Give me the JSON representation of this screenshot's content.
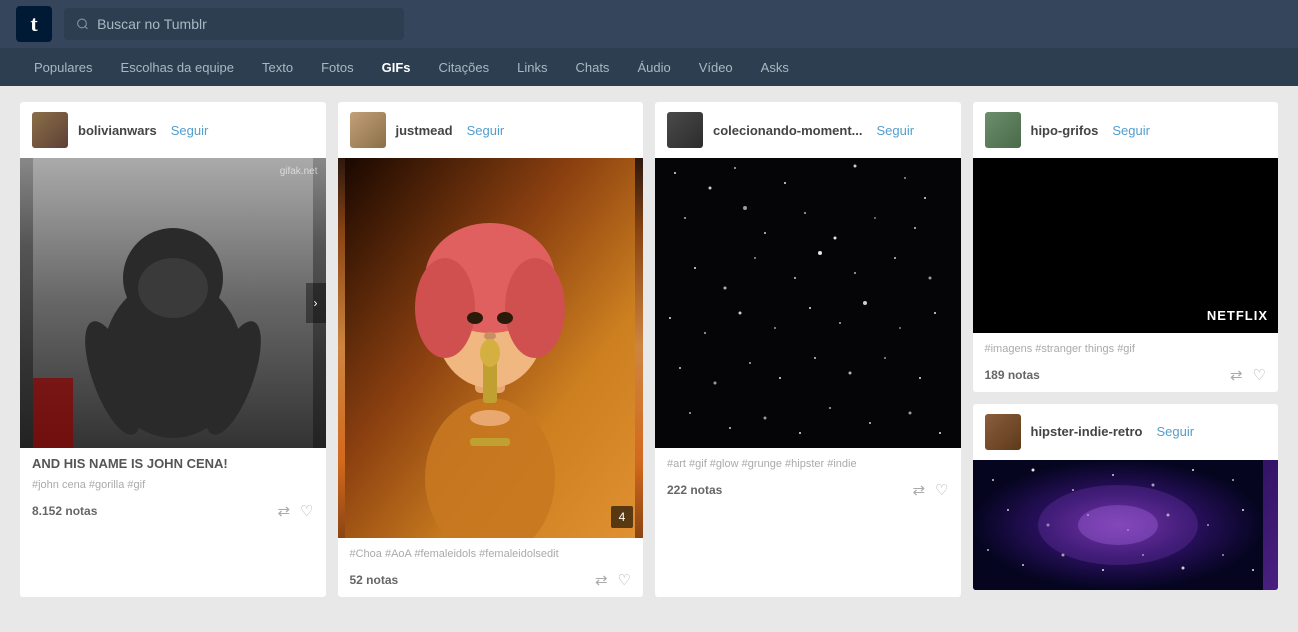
{
  "app": {
    "logo": "t",
    "search_placeholder": "Buscar no Tumblr"
  },
  "nav": {
    "items": [
      {
        "label": "Populares",
        "active": false
      },
      {
        "label": "Escolhas da equipe",
        "active": false
      },
      {
        "label": "Texto",
        "active": false
      },
      {
        "label": "Fotos",
        "active": false
      },
      {
        "label": "GIFs",
        "active": true
      },
      {
        "label": "Citações",
        "active": false
      },
      {
        "label": "Links",
        "active": false
      },
      {
        "label": "Chats",
        "active": false
      },
      {
        "label": "Áudio",
        "active": false
      },
      {
        "label": "Vídeo",
        "active": false
      },
      {
        "label": "Asks",
        "active": false
      }
    ]
  },
  "posts": [
    {
      "id": "post1",
      "username": "bolivianwars",
      "follow_label": "Seguir",
      "image_type": "gorilla",
      "image_watermark": "gifak.net",
      "text": "AND HIS NAME IS JOHN CENA!",
      "tags": "#john cena  #gorilla  #gif",
      "notes": "8.152 notas"
    },
    {
      "id": "post2",
      "username": "justmead",
      "follow_label": "Seguir",
      "image_type": "singer",
      "image_badge": "4",
      "text": "",
      "tags": "#Choa  #AoA  #femaleidols  #femaleidolsedit",
      "notes": "52 notas"
    },
    {
      "id": "post3",
      "username": "colecionando-moment...",
      "follow_label": "Seguir",
      "image_type": "space",
      "text": "",
      "tags": "#art  #gif  #glow  #grunge  #hipster  #indie",
      "notes": "222 notas"
    },
    {
      "id": "post4a",
      "username": "hipo-grifos",
      "follow_label": "Seguir",
      "image_type": "netflix",
      "netflix_text": "NETFLIX",
      "text": "",
      "tags": "#imagens  #stranger things  #gif",
      "notes": "189 notas"
    }
  ],
  "posts_bottom": [
    {
      "id": "post5",
      "username": "hipster-indie-retro",
      "follow_label": "Seguir",
      "image_type": "galaxy"
    }
  ],
  "icons": {
    "search": "🔍",
    "reblog": "⇄",
    "heart": "♡",
    "chevron_left": "‹",
    "chevron_right": "›"
  }
}
